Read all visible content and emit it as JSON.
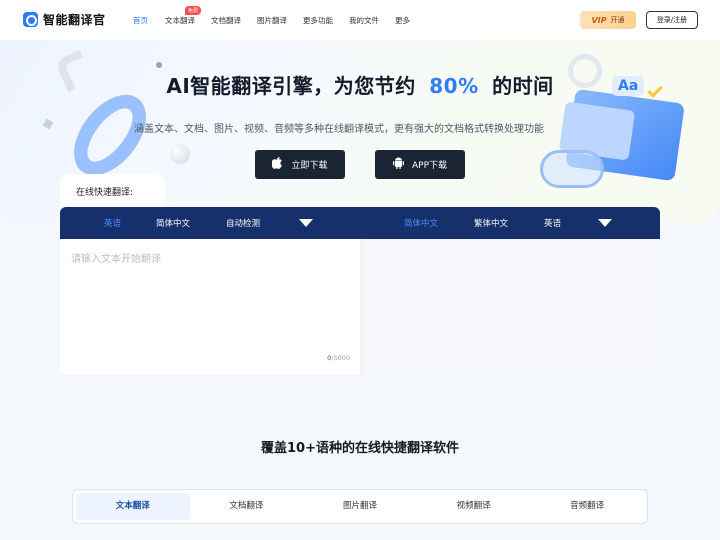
{
  "header": {
    "logo_text": "智能翻译官",
    "nav": [
      {
        "label": "首页",
        "active": true
      },
      {
        "label": "文本翻译",
        "badge": "免费"
      },
      {
        "label": "文档翻译"
      },
      {
        "label": "图片翻译"
      },
      {
        "label": "更多功能"
      },
      {
        "label": "我的文件"
      },
      {
        "label": "更多"
      }
    ],
    "vip_mark": "VIP",
    "vip_label": "开通",
    "login_label": "登录/注册"
  },
  "hero": {
    "title_prefix": "AI智能翻译引擎，为您节约",
    "title_percent": "80%",
    "title_suffix": "的时间",
    "subtitle": "涵盖文本、文档、图片、视频、音频等多种在线翻译模式，更有强大的文档格式转换处理功能",
    "download_button": "立即下载",
    "app_button": "APP下载",
    "deco_text": "Aa"
  },
  "translator": {
    "quick_label": "在线快速翻译:",
    "source_langs": [
      "英语",
      "简体中文",
      "自动检测"
    ],
    "target_langs": [
      "简体中文",
      "繁体中文",
      "英语"
    ],
    "input_placeholder": "请输入文本开始翻译",
    "count_current": "0",
    "count_max": "/5000"
  },
  "section": {
    "title": "覆盖10+语种的在线快捷翻译软件",
    "tabs": [
      "文本翻译",
      "文档翻译",
      "图片翻译",
      "视频翻译",
      "音频翻译"
    ]
  },
  "colors": {
    "accent": "#2f7cf6",
    "lang_bar": "#15306b",
    "dark_button": "#1b2433"
  }
}
